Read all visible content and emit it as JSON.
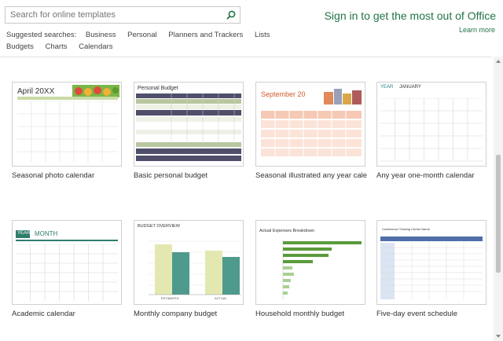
{
  "search": {
    "placeholder": "Search for online templates"
  },
  "suggested": {
    "label": "Suggested searches:",
    "items": [
      "Business",
      "Personal",
      "Planners and Trackers",
      "Lists",
      "Budgets",
      "Charts",
      "Calendars"
    ]
  },
  "signin": {
    "title": "Sign in to get the most out of Office",
    "learn_more": "Learn more"
  },
  "colors": {
    "accent": "#217346"
  },
  "templates": [
    {
      "caption": "Seasonal photo calendar",
      "thumb_title": "April 20XX"
    },
    {
      "caption": "Basic personal budget",
      "thumb_title": "Personal Budget"
    },
    {
      "caption": "Seasonal illustrated any year cale...",
      "thumb_title": "September 20"
    },
    {
      "caption": "Any year one-month calendar",
      "thumb_title": "JANUARY",
      "thumb_year": "YEAR"
    },
    {
      "caption": "Academic calendar",
      "thumb_title": "MONTH",
      "thumb_year": "YEAR"
    },
    {
      "caption": "Monthly company budget",
      "thumb_title": "BUDGET OVERVIEW",
      "bar_labels": [
        "ESTIMATED",
        "ACTUAL"
      ]
    },
    {
      "caption": "Household monthly budget",
      "thumb_title": "Actual Expenses Breakdown"
    },
    {
      "caption": "Five-day event schedule",
      "thumb_title": "Conference Training Center Name"
    }
  ]
}
